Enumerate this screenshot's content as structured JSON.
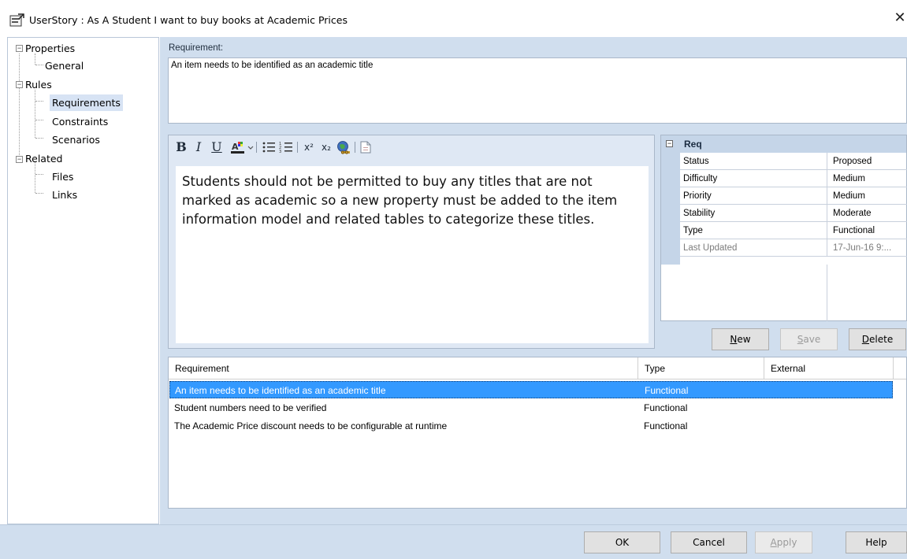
{
  "window": {
    "title": "UserStory : As A Student I want to buy books at Academic Prices",
    "close_glyph": "✕"
  },
  "tree": {
    "items": [
      {
        "label": "Properties",
        "expander": "−"
      },
      {
        "label": "General"
      },
      {
        "label": "Rules",
        "expander": "−"
      },
      {
        "label": "Requirements",
        "selected": true
      },
      {
        "label": "Constraints"
      },
      {
        "label": "Scenarios"
      },
      {
        "label": "Related",
        "expander": "−"
      },
      {
        "label": "Files"
      },
      {
        "label": "Links"
      }
    ]
  },
  "requirement": {
    "label": "Requirement:",
    "value": "An item needs to be identified as an academic title"
  },
  "editor": {
    "toolbar": {
      "bold": "B",
      "italic": "I",
      "underline": "U",
      "superscript": "x²",
      "subscript": "x₂"
    },
    "text": "Students should not be permitted to buy any titles that are not marked as academic so a new property must be added to the item information model and related tables to categorize these titles."
  },
  "properties": {
    "group": "Req",
    "expander": "−",
    "rows": [
      {
        "key": "Status",
        "value": "Proposed"
      },
      {
        "key": "Difficulty",
        "value": "Medium"
      },
      {
        "key": "Priority",
        "value": "Medium"
      },
      {
        "key": "Stability",
        "value": "Moderate"
      },
      {
        "key": "Type",
        "value": "Functional"
      },
      {
        "key": "Last Updated",
        "value": "17-Jun-16 9:...",
        "muted": true
      }
    ]
  },
  "buttons": {
    "new": {
      "label": "New",
      "accel": "N",
      "rest": "ew"
    },
    "save": {
      "label": "Save",
      "accel": "S",
      "rest": "ave"
    },
    "delete": {
      "label": "Delete",
      "accel": "D",
      "rest": "elete"
    },
    "ok": "OK",
    "cancel": "Cancel",
    "apply": {
      "accel": "A",
      "rest": "pply"
    },
    "help": "Help"
  },
  "list": {
    "columns": [
      "Requirement",
      "Type",
      "External"
    ],
    "rows": [
      {
        "requirement": "An item needs to be identified as an academic title",
        "type": "Functional",
        "selected": true
      },
      {
        "requirement": "Student numbers need to be verified",
        "type": "Functional"
      },
      {
        "requirement": "The Academic Price discount needs to be configurable at runtime",
        "type": "Functional"
      }
    ]
  },
  "colors": {
    "panel": "#d0deee",
    "selection": "#3399ff",
    "tree_selection": "#d7e3f4"
  }
}
